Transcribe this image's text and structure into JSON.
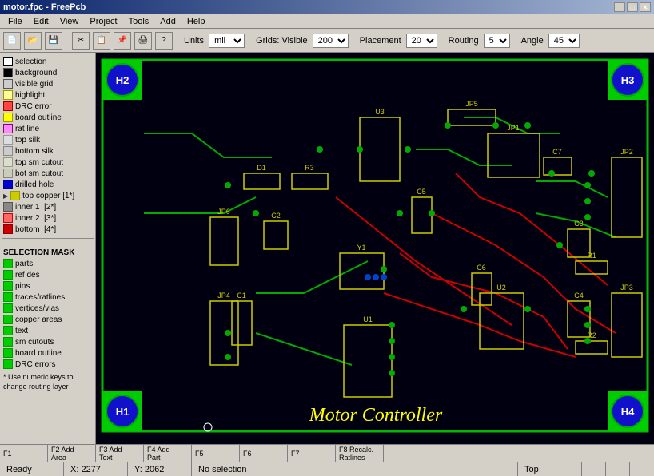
{
  "titlebar": {
    "title": "motor.fpc - FreePcb",
    "controls": [
      "_",
      "□",
      "✕"
    ]
  },
  "menubar": {
    "items": [
      "File",
      "Edit",
      "View",
      "Project",
      "Tools",
      "Add",
      "Help"
    ]
  },
  "toolbar": {
    "units_label": "Units",
    "units_value": "mil",
    "grids_label": "Grids: Visible",
    "grids_value": "200",
    "placement_label": "Placement",
    "placement_value": "20",
    "routing_label": "Routing",
    "routing_value": "5",
    "angle_label": "Angle",
    "angle_value": "45"
  },
  "layers": [
    {
      "name": "selection",
      "color": "#ffffff",
      "border": "#000000"
    },
    {
      "name": "background",
      "color": "#000000",
      "border": "#555555"
    },
    {
      "name": "visible grid",
      "color": "#ffffff",
      "border": "#555555"
    },
    {
      "name": "highlight",
      "color": "#ffffff",
      "border": "#555555"
    },
    {
      "name": "DRC error",
      "color": "#ff0000",
      "border": "#990000"
    },
    {
      "name": "board outline",
      "color": "#ffff00",
      "border": "#999900"
    },
    {
      "name": "rat line",
      "color": "#ff00ff",
      "border": "#990099"
    },
    {
      "name": "top silk",
      "color": "#dddddd",
      "border": "#999999"
    },
    {
      "name": "bottom silk",
      "color": "#dddddd",
      "border": "#999999"
    },
    {
      "name": "top sm cutout",
      "color": "#dddddd",
      "border": "#999999"
    },
    {
      "name": "bot sm cutout",
      "color": "#dddddd",
      "border": "#999999"
    },
    {
      "name": "drilled hole",
      "color": "#0000cc",
      "border": "#000099"
    },
    {
      "name": "top copper [1*]",
      "color": "#cccc00",
      "border": "#999900",
      "arrow": true
    },
    {
      "name": "inner 1  [2*]",
      "color": "#888888",
      "border": "#555555"
    },
    {
      "name": "inner 2  [3*]",
      "color": "#ff4444",
      "border": "#990000"
    },
    {
      "name": "bottom  [4*]",
      "color": "#cc0000",
      "border": "#880000"
    }
  ],
  "selection_mask": {
    "title": "SELECTION MASK",
    "items": [
      "parts",
      "ref des",
      "pins",
      "traces/ratlines",
      "vertices/vias",
      "copper areas",
      "text",
      "sm cutouts",
      "board outline",
      "DRC errors"
    ]
  },
  "note": "* Use numeric keys to change routing layer",
  "pcb": {
    "title": "Motor Controller",
    "corners": [
      "H1",
      "H2",
      "H3",
      "H4"
    ],
    "components": [
      "U1",
      "U2",
      "U3",
      "Y1",
      "C1",
      "C2",
      "C3",
      "C4",
      "C5",
      "C6",
      "C7",
      "D1",
      "R1",
      "R2",
      "R3",
      "JP1",
      "JP2",
      "JP3",
      "JP4",
      "JP5",
      "JP6"
    ]
  },
  "fkeys": [
    {
      "key": "F1",
      "label": ""
    },
    {
      "key": "F2",
      "label": "Add\nArea"
    },
    {
      "key": "F3",
      "label": "Add\nText"
    },
    {
      "key": "F4",
      "label": "Add\nPart"
    },
    {
      "key": "F5",
      "label": ""
    },
    {
      "key": "F6",
      "label": ""
    },
    {
      "key": "F7",
      "label": ""
    },
    {
      "key": "F8",
      "label": "Recalc.\nRatlines"
    }
  ],
  "statusbar": {
    "ready": "Ready",
    "x": "X: 2277",
    "y": "Y: 2062",
    "selection": "No selection",
    "layer": "Top"
  }
}
